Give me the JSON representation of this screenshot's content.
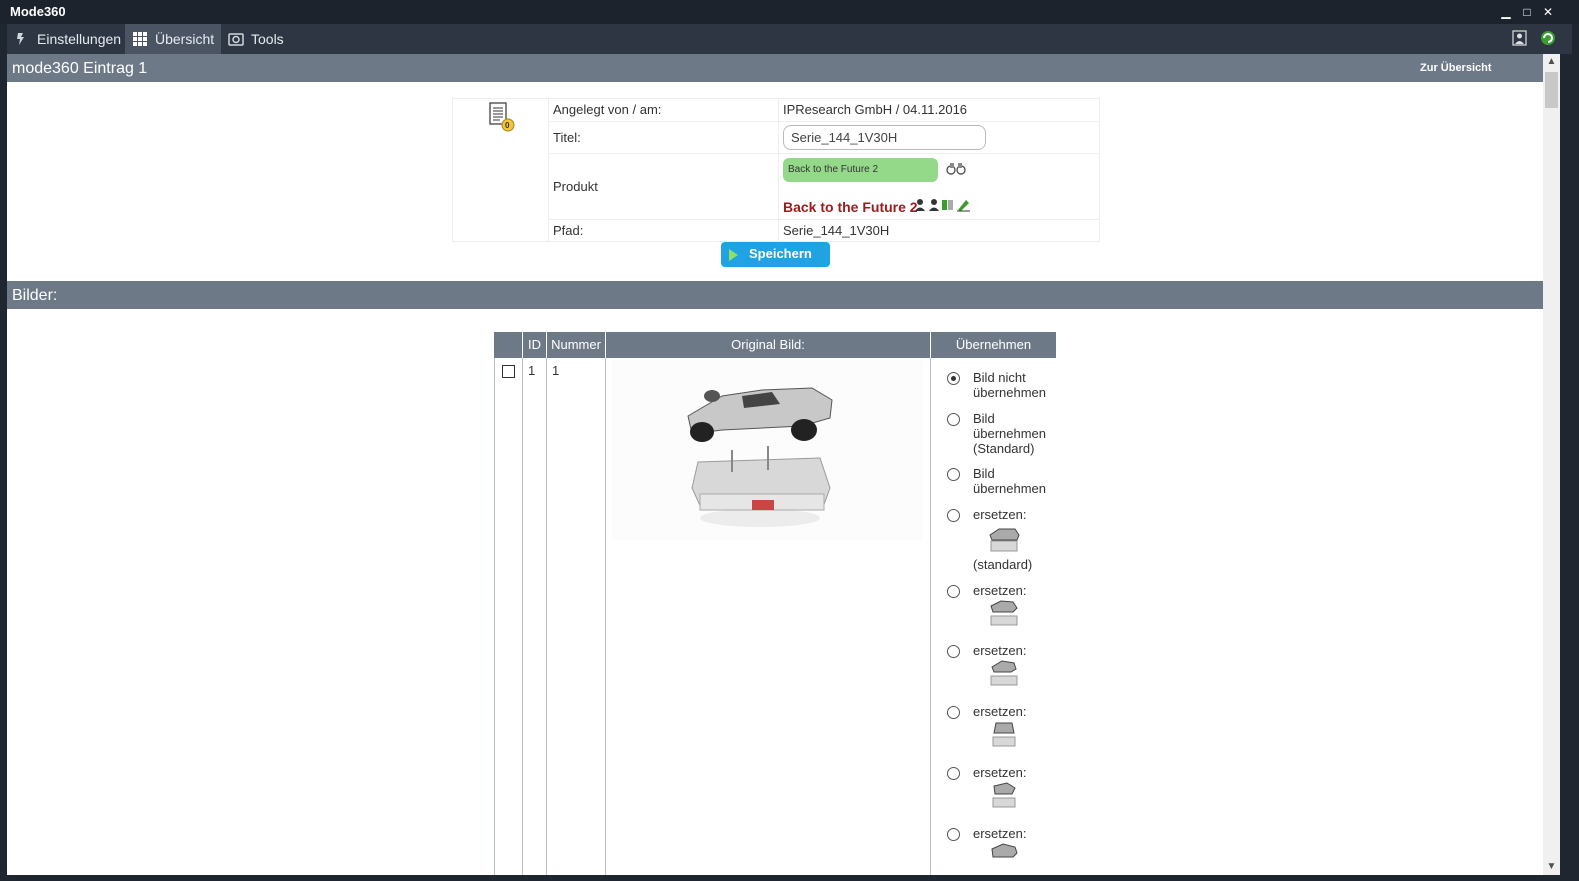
{
  "window": {
    "title": "Mode360",
    "minimize": "▁",
    "maximize": "□",
    "close": "✕"
  },
  "menu": [
    {
      "label": "Einstellungen",
      "icon": "tools-icon"
    },
    {
      "label": "Übersicht",
      "icon": "grid-icon"
    },
    {
      "label": "Tools",
      "icon": "camera-icon"
    }
  ],
  "header": {
    "title": "mode360 Eintrag 1",
    "back_link": "Zur Übersicht"
  },
  "entry": {
    "badge_count": "0",
    "created_label": "Angelegt von / am:",
    "created_value": "IPResearch GmbH / 04.11.2016",
    "title_label": "Titel:",
    "title_value": "Serie_144_1V30H",
    "product_label": "Produkt",
    "product_chip": "Back to the Future 2",
    "product_link": "Back to the Future 2",
    "path_label": "Pfad:",
    "path_value": "Serie_144_1V30H",
    "save_label": "Speichern"
  },
  "images_section": {
    "title": "Bilder:"
  },
  "images_table": {
    "columns": [
      "",
      "ID",
      "Nummer",
      "Original Bild:",
      "Übernehmen"
    ],
    "rows": [
      {
        "id": "1",
        "nummer": "1",
        "options": [
          {
            "label": "Bild nicht übernehmen",
            "checked": true
          },
          {
            "label": "Bild übernehmen (Standard)",
            "checked": false
          },
          {
            "label": "Bild übernehmen",
            "checked": false
          },
          {
            "label": "ersetzen:",
            "note": "(standard)",
            "checked": false
          },
          {
            "label": "ersetzen:",
            "checked": false
          },
          {
            "label": "ersetzen:",
            "checked": false
          },
          {
            "label": "ersetzen:",
            "checked": false
          },
          {
            "label": "ersetzen:",
            "checked": false
          },
          {
            "label": "ersetzen:",
            "checked": false
          }
        ]
      }
    ]
  },
  "colors": {
    "titlebar": "#1c232d",
    "menubar": "#2d3642",
    "section": "#6e7988",
    "save": "#20a3e3",
    "chip": "#94d98a",
    "product_link": "#9b1c1c"
  }
}
